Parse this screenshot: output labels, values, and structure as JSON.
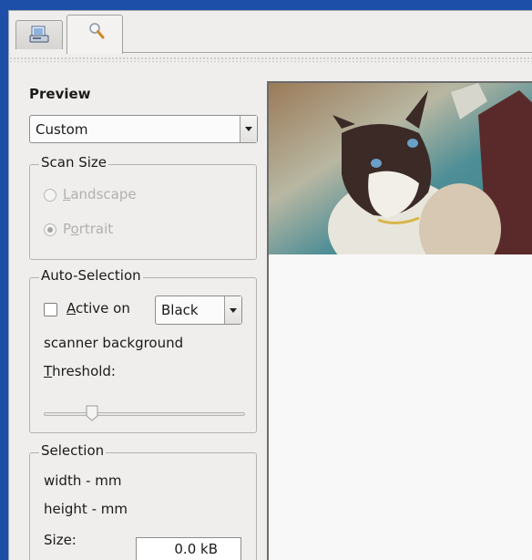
{
  "tabs": [
    {
      "name": "scan",
      "icon": "scanner-icon"
    },
    {
      "name": "preview",
      "icon": "magnifier-icon"
    }
  ],
  "panel": {
    "title": "Preview",
    "preset": "Custom",
    "scan_size": {
      "legend": "Scan Size",
      "landscape": "Landscape",
      "portrait": "Portrait"
    },
    "auto_selection": {
      "legend": "Auto-Selection",
      "active_on": "Active on",
      "color_value": "Black",
      "scanner_bg": "scanner background",
      "threshold": "Threshold:",
      "threshold_value": 0.22
    },
    "selection": {
      "legend": "Selection",
      "width": "width - mm",
      "height": "height - mm",
      "size_label": "Size:",
      "size_value": "0.0 kB"
    }
  },
  "colors": {
    "desktop": "#1d4fa8",
    "window": "#efeeec",
    "disabled_text": "#b1b0ad"
  }
}
